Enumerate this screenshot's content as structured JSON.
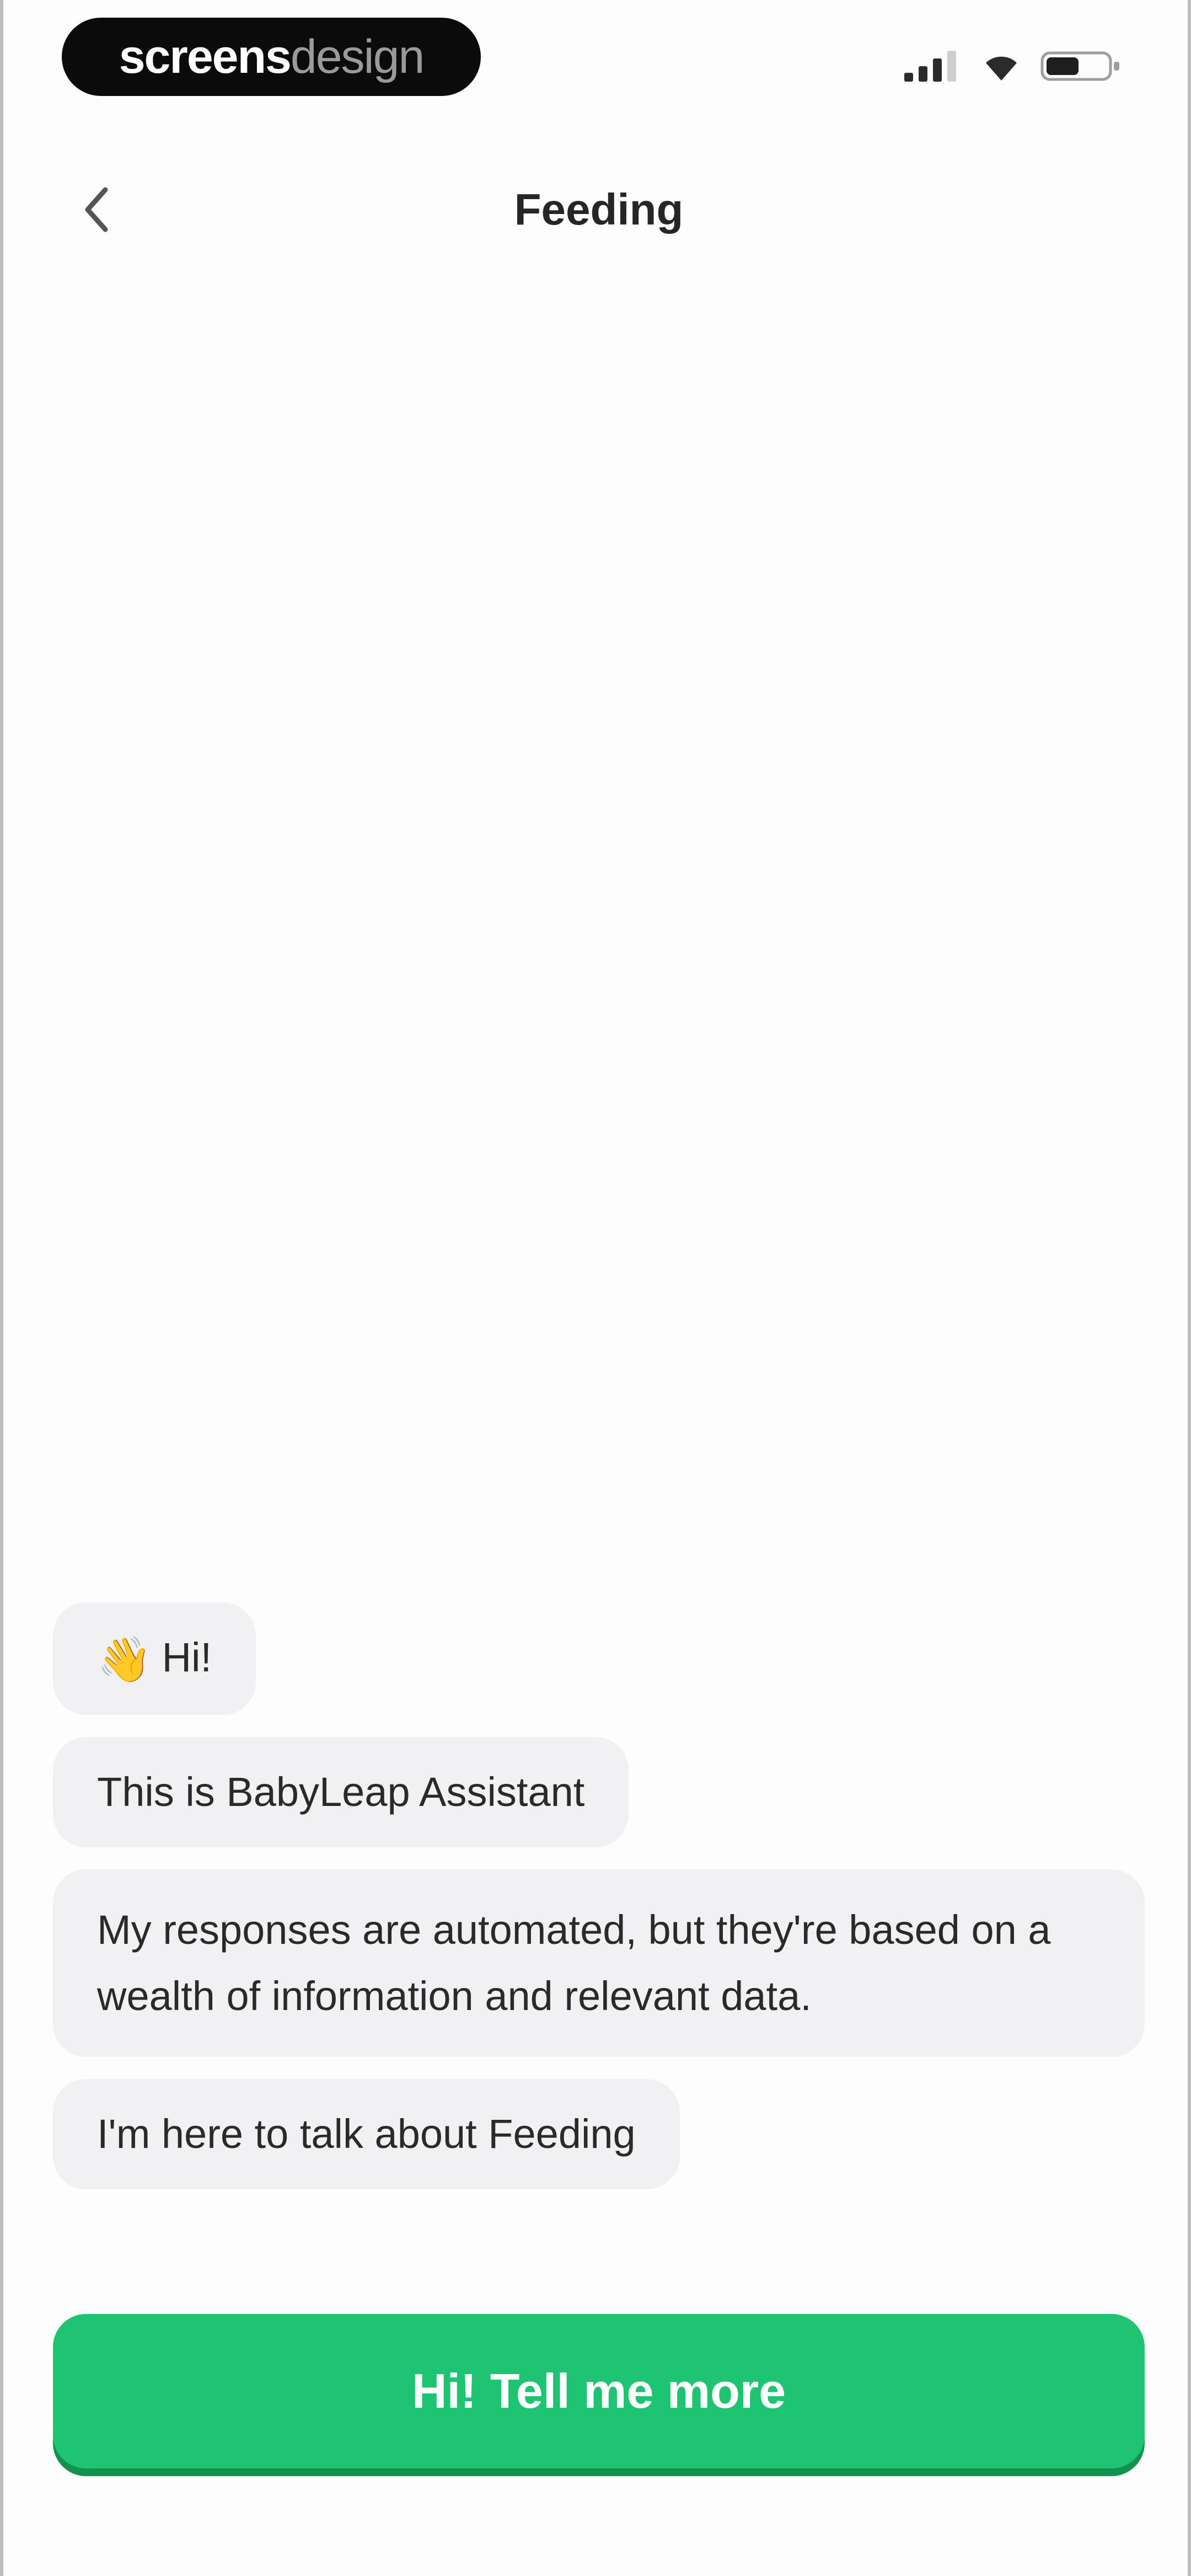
{
  "status_bar": {
    "brand": {
      "strong": "screens",
      "light": "design"
    },
    "icons": [
      "signal-icon",
      "wifi-icon",
      "battery-icon"
    ]
  },
  "header": {
    "title": "Feeding",
    "back_icon": "chevron-left-icon"
  },
  "chat": {
    "messages": [
      {
        "emoji": "👋",
        "text": "Hi!"
      },
      {
        "text": "This is BabyLeap Assistant"
      },
      {
        "text": "My responses are automated, but they're based on a wealth of information and relevant data."
      },
      {
        "text": "I'm here to talk about Feeding"
      }
    ]
  },
  "cta": {
    "label": "Hi! Tell me more"
  },
  "colors": {
    "accent": "#1fc473",
    "bubble": "#f1f1f3",
    "text": "#2a2a2a"
  }
}
